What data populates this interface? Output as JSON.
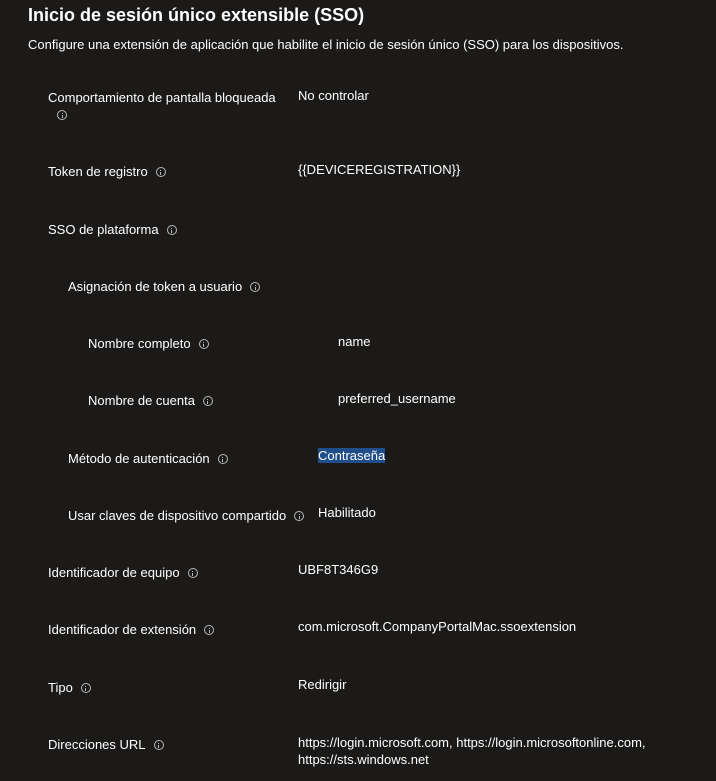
{
  "page": {
    "title": "Inicio de sesión único extensible (SSO)",
    "description": "Configure una extensión de aplicación que habilite el inicio de sesión único (SSO) para los dispositivos."
  },
  "settings": [
    {
      "label": "Comportamiento de pantalla bloqueada",
      "value": "No controlar"
    },
    {
      "label": "Token de registro",
      "value": "{{DEVICEREGISTRATION}}"
    },
    {
      "label": "SSO de plataforma",
      "value": ""
    },
    {
      "label": "Asignación de token a usuario",
      "value": ""
    },
    {
      "label": "Nombre completo",
      "value": "name"
    },
    {
      "label": "Nombre de cuenta",
      "value": "preferred_username"
    },
    {
      "label": "Método de autenticación",
      "value": "Contraseña"
    },
    {
      "label": "Usar claves de dispositivo compartido",
      "value": "Habilitado"
    },
    {
      "label": "Identificador de equipo",
      "value": "UBF8T346G9"
    },
    {
      "label": "Identificador de extensión",
      "value": "com.microsoft.CompanyPortalMac.ssoextension"
    },
    {
      "label": "Tipo",
      "value": "Redirigir"
    },
    {
      "label": "Direcciones URL",
      "value": "https://login.microsoft.com, https://login.microsoftonline.com, https://sts.windows.net"
    }
  ]
}
